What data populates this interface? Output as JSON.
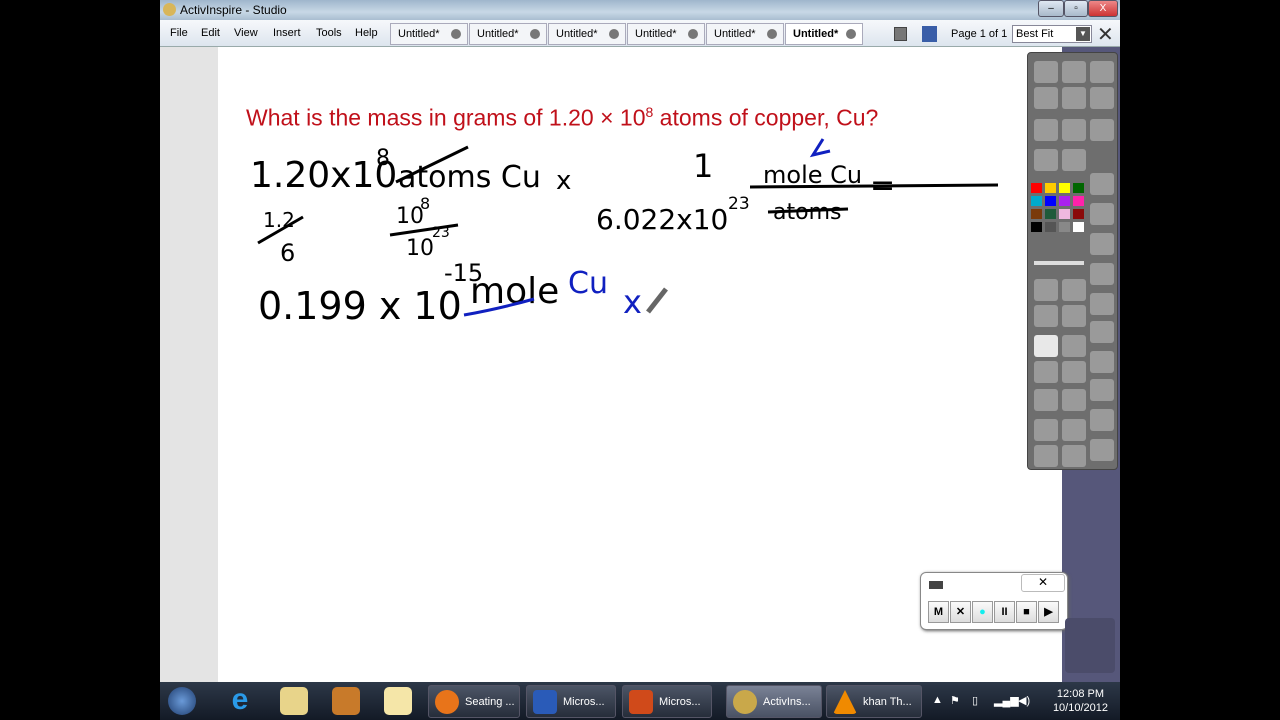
{
  "window": {
    "title": "ActivInspire - Studio",
    "minimize": "–",
    "maximize": "▫",
    "close": "X"
  },
  "menu": [
    "File",
    "Edit",
    "View",
    "Insert",
    "Tools",
    "Help"
  ],
  "tabs": [
    {
      "label": "Untitled*",
      "active": false
    },
    {
      "label": "Untitled*",
      "active": false
    },
    {
      "label": "Untitled*",
      "active": false
    },
    {
      "label": "Untitled*",
      "active": false
    },
    {
      "label": "Untitled*",
      "active": false
    },
    {
      "label": "Untitled*",
      "active": true
    }
  ],
  "page_indicator": "Page 1 of 1",
  "zoom_select": "Best Fit",
  "canvas": {
    "question": {
      "prefix": "What is the mass in grams of 1.20 × 10",
      "exp": "8",
      "suffix": " atoms of copper, Cu?",
      "color": "#c0101a"
    },
    "handwriting": {
      "line1_left": "1.20x10",
      "line1_exp": "8",
      "line1_unit": "atoms Cu",
      "times": "x",
      "numerator": "1",
      "num_unit": "mole Cu",
      "denominator": "6.022x10",
      "den_exp": "23",
      "den_unit": "atoms",
      "equals": "=",
      "work1_num": "1.2",
      "work1_den": "6",
      "work2_num": "10",
      "work2_num_exp": "8",
      "work2_den": "10",
      "work2_den_exp": "23",
      "result": "0.199 x 10",
      "result_exp": "-15",
      "result_unit": "mole",
      "blue_note": "Cu",
      "blue_x": "x"
    },
    "ink_colors": {
      "black": "#000000",
      "blue": "#1020c0"
    }
  },
  "toolbox": {
    "colors": [
      "#ff0000",
      "#ffcc00",
      "#ffff00",
      "#006600",
      "#00aacc",
      "#0000ff",
      "#aa22ee",
      "#ff22aa",
      "#7a3a0a",
      "#1f5a3a",
      "#f0b8e0",
      "#8a0a0a",
      "#000000",
      "#555555",
      "#888888",
      "#ffffff"
    ]
  },
  "recorder": {
    "buttons": [
      "M",
      "✕",
      "●",
      "II",
      "■",
      "▶"
    ],
    "close": "✕"
  },
  "taskbar": {
    "items": [
      {
        "label": "Seating ...",
        "color": "#e8741a"
      },
      {
        "label": "Micros...",
        "color": "#2a5bb8"
      },
      {
        "label": "Micros...",
        "color": "#d04a1a"
      },
      {
        "label": "ActivIns...",
        "color": "#c9a84a"
      },
      {
        "label": "khan Th...",
        "color": "#f08a00"
      }
    ],
    "time": "12:08 PM",
    "date": "10/10/2012"
  }
}
